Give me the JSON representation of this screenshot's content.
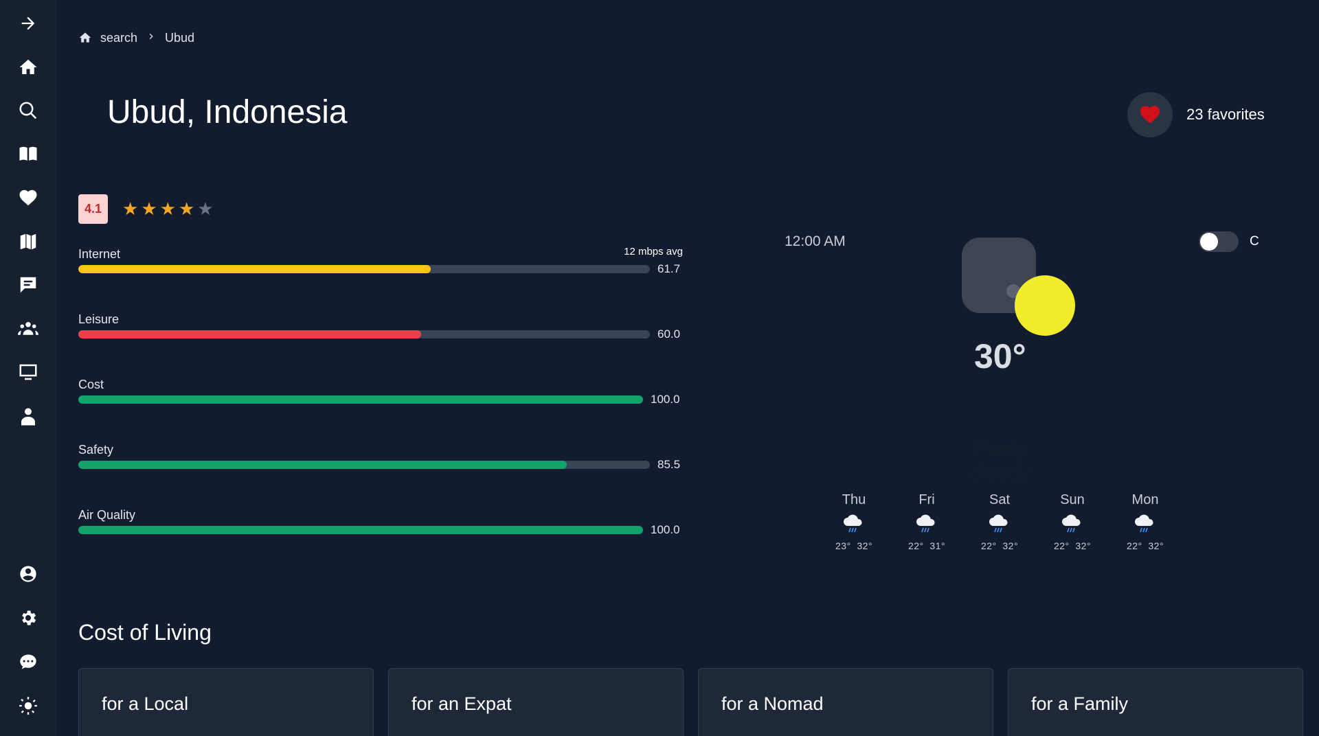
{
  "sidebar": {
    "items": [
      {
        "name": "collapse",
        "icon": "arrow-right-icon"
      },
      {
        "name": "home",
        "icon": "home-icon"
      },
      {
        "name": "search",
        "icon": "search-icon"
      },
      {
        "name": "guide",
        "icon": "book-icon"
      },
      {
        "name": "favorites",
        "icon": "heart-icon"
      },
      {
        "name": "map",
        "icon": "map-icon"
      },
      {
        "name": "chat",
        "icon": "chat-icon"
      },
      {
        "name": "community",
        "icon": "people-icon"
      },
      {
        "name": "workspaces",
        "icon": "monitor-icon"
      },
      {
        "name": "user-profile",
        "icon": "person-icon"
      },
      {
        "name": "account",
        "icon": "account-circle-icon"
      },
      {
        "name": "settings",
        "icon": "gear-icon"
      },
      {
        "name": "messages",
        "icon": "message-bubble-icon"
      },
      {
        "name": "theme",
        "icon": "sun-icon"
      }
    ]
  },
  "breadcrumb": {
    "home_icon": "home-icon",
    "search_label": "search",
    "current_label": "Ubud"
  },
  "header": {
    "title": "Ubud, Indonesia",
    "favorites_label": "23 favorites",
    "favorite_icon": "heart-icon"
  },
  "rating": {
    "score": "4.1",
    "stars_filled": 4,
    "stars_total": 5
  },
  "metrics": [
    {
      "label": "Internet",
      "extra": "12 mbps avg",
      "value": "61.7",
      "fraction": 0.617,
      "color": "#f5c518"
    },
    {
      "label": "Leisure",
      "extra": "",
      "value": "60.0",
      "fraction": 0.6,
      "color": "#e9414a"
    },
    {
      "label": "Cost",
      "extra": "",
      "value": "100.0",
      "fraction": 1.0,
      "color": "#12a36a"
    },
    {
      "label": "Safety",
      "extra": "",
      "value": "85.5",
      "fraction": 0.855,
      "color": "#12a36a"
    },
    {
      "label": "Air Quality",
      "extra": "",
      "value": "100.0",
      "fraction": 1.0,
      "color": "#12a36a"
    }
  ],
  "weather": {
    "time": "12:00 AM",
    "unit": "C",
    "temperature": "30°",
    "description": "Partly cloudy",
    "forecast": [
      {
        "day": "Thu",
        "low": "23°",
        "high": "32°",
        "icon": "rain-cloud-icon"
      },
      {
        "day": "Fri",
        "low": "22°",
        "high": "31°",
        "icon": "rain-cloud-icon"
      },
      {
        "day": "Sat",
        "low": "22°",
        "high": "32°",
        "icon": "rain-cloud-icon"
      },
      {
        "day": "Sun",
        "low": "22°",
        "high": "32°",
        "icon": "rain-cloud-icon"
      },
      {
        "day": "Mon",
        "low": "22°",
        "high": "32°",
        "icon": "rain-cloud-icon"
      }
    ]
  },
  "cost_of_living": {
    "title": "Cost of Living",
    "cards": [
      "for a Local",
      "for an Expat",
      "for a Nomad",
      "for a Family"
    ]
  },
  "colors": {
    "background": "#131c2e",
    "sidebar": "#17202f",
    "star_filled": "#f5a623",
    "star_empty": "#6b7280",
    "heart": "#d2101b",
    "sun": "#f2ec2c"
  }
}
